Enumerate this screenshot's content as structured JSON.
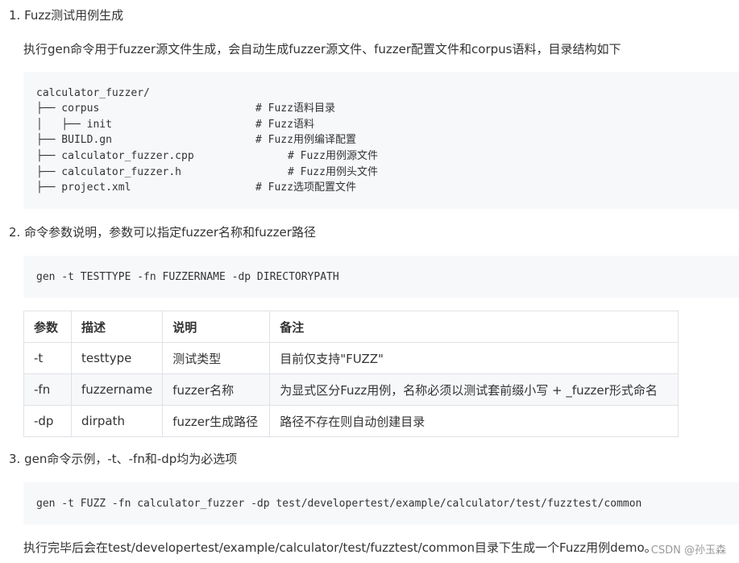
{
  "sections": [
    {
      "heading": "1. Fuzz测试用例生成",
      "paragraph": "执行gen命令用于fuzzer源文件生成，会自动生成fuzzer源文件、fuzzer配置文件和corpus语料，目录结构如下"
    },
    {
      "heading": "2. 命令参数说明，参数可以指定fuzzer名称和fuzzer路径"
    },
    {
      "heading": "3. gen命令示例，-t、-fn和-dp均为必选项"
    }
  ],
  "tree": {
    "root": "calculator_fuzzer/",
    "lines": [
      {
        "code": "├── corpus",
        "comment": "# Fuzz语料目录"
      },
      {
        "code": "│   ├── init",
        "comment": "# Fuzz语料"
      },
      {
        "code": "├── BUILD.gn",
        "comment": "# Fuzz用例编译配置"
      },
      {
        "code": "├── calculator_fuzzer.cpp",
        "comment": "# Fuzz用例源文件"
      },
      {
        "code": "├── calculator_fuzzer.h",
        "comment": "# Fuzz用例头文件"
      },
      {
        "code": "├── project.xml",
        "comment": "# Fuzz选项配置文件"
      }
    ]
  },
  "command_syntax": "gen -t TESTTYPE -fn FUZZERNAME -dp DIRECTORYPATH",
  "params_table": {
    "headers": [
      "参数",
      "描述",
      "说明",
      "备注"
    ],
    "rows": [
      [
        "-t",
        "testtype",
        "测试类型",
        "目前仅支持\"FUZZ\""
      ],
      [
        "-fn",
        "fuzzername",
        "fuzzer名称",
        "为显式区分Fuzz用例，名称必须以测试套前缀小写 + _fuzzer形式命名"
      ],
      [
        "-dp",
        "dirpath",
        "fuzzer生成路径",
        "路径不存在则自动创建目录"
      ]
    ]
  },
  "command_example": "gen -t FUZZ -fn calculator_fuzzer -dp test/developertest/example/calculator/test/fuzztest/common",
  "result_text": "执行完毕后会在test/developertest/example/calculator/test/fuzztest/common目录下生成一个Fuzz用例demo。",
  "watermark": "CSDN @孙玉森"
}
